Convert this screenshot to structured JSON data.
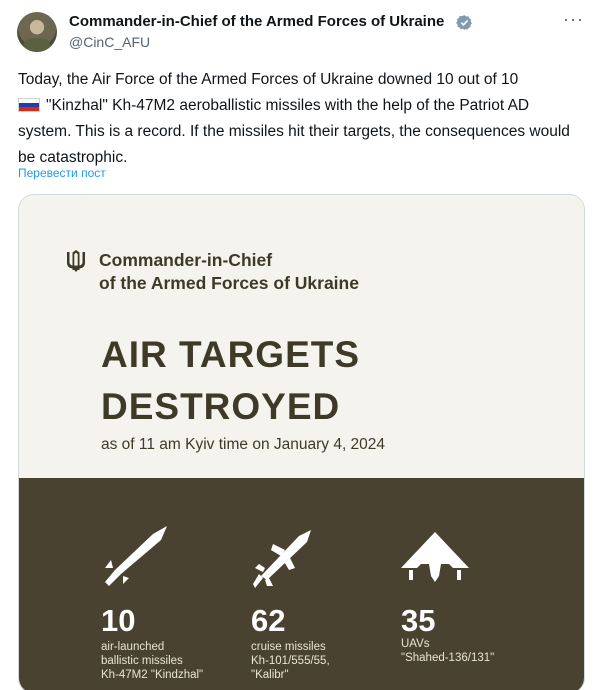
{
  "author": {
    "name": "Commander-in-Chief of the Armed Forces of Ukraine",
    "handle": "@CinC_AFU",
    "verified_icon": "verified-badge-icon",
    "more_icon": "more-options-icon"
  },
  "tweet": {
    "text_before_flag": "Today, the Air Force of the Armed Forces of Ukraine downed 10 out of 10",
    "text_after_flag": "\"Kinzhal\" Kh-47M2 aeroballistic missiles with the help of the Patriot AD system. This is a record.  If the missiles hit their targets, the consequences would be catastrophic.",
    "translate_label": "Перевести пост"
  },
  "card": {
    "org_line1": "Commander-in-Chief",
    "org_line2": "of the Armed Forces of Ukraine",
    "headline_line1": "AIR TARGETS",
    "headline_line2": "DESTROYED",
    "subheadline": "as of 11 am Kyiv time on January 4, 2024",
    "stats": [
      {
        "icon": "ballistic-missile-icon",
        "number": "10",
        "lines": [
          "air-launched",
          "ballistic missiles",
          "Kh-47M2 \"Kindzhal\""
        ]
      },
      {
        "icon": "cruise-missile-icon",
        "number": "62",
        "lines": [
          "cruise missiles",
          "Kh-101/555/55,",
          "\"Kalibr\""
        ]
      },
      {
        "icon": "uav-icon",
        "number": "35",
        "lines": [
          "UAVs",
          "\"Shahed-136/131\""
        ]
      }
    ]
  },
  "colors": {
    "link_blue": "#1d9bf0",
    "card_dark": "#4a4230",
    "card_text": "#3e3a27"
  }
}
